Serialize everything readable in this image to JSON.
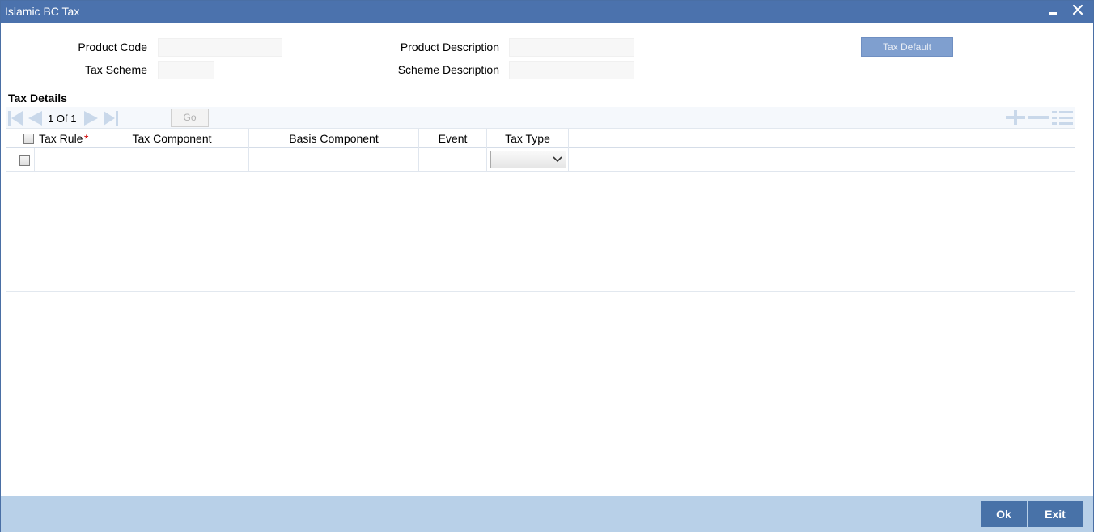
{
  "window": {
    "title": "Islamic BC Tax"
  },
  "form": {
    "product_code_label": "Product Code",
    "product_code_value": "",
    "product_description_label": "Product Description",
    "product_description_value": "",
    "tax_scheme_label": "Tax Scheme",
    "tax_scheme_value": "",
    "scheme_description_label": "Scheme Description",
    "scheme_description_value": "",
    "tax_default_button": "Tax Default"
  },
  "tax_details": {
    "title": "Tax Details",
    "pager": {
      "current": "1",
      "of_label": "Of",
      "total": "1",
      "go_label": "Go",
      "page_input_value": ""
    },
    "columns": [
      "Tax Rule",
      "Tax Component",
      "Basis Component",
      "Event",
      "Tax Type"
    ],
    "required_mark": "*",
    "rows": [
      {
        "tax_rule": "",
        "tax_component": "",
        "basis_component": "",
        "event": "",
        "tax_type": ""
      }
    ]
  },
  "footer": {
    "ok_label": "Ok",
    "exit_label": "Exit"
  },
  "colors": {
    "titlebar": "#4b72ad",
    "footer": "#b8d0e8",
    "button": "#4872a8",
    "disabled_button": "#7f9fcf"
  },
  "icons": [
    "minimize-icon",
    "close-icon",
    "first-page-icon",
    "previous-page-icon",
    "next-page-icon",
    "last-page-icon",
    "add-row-icon",
    "delete-row-icon",
    "single-view-icon",
    "chevron-down-icon"
  ]
}
